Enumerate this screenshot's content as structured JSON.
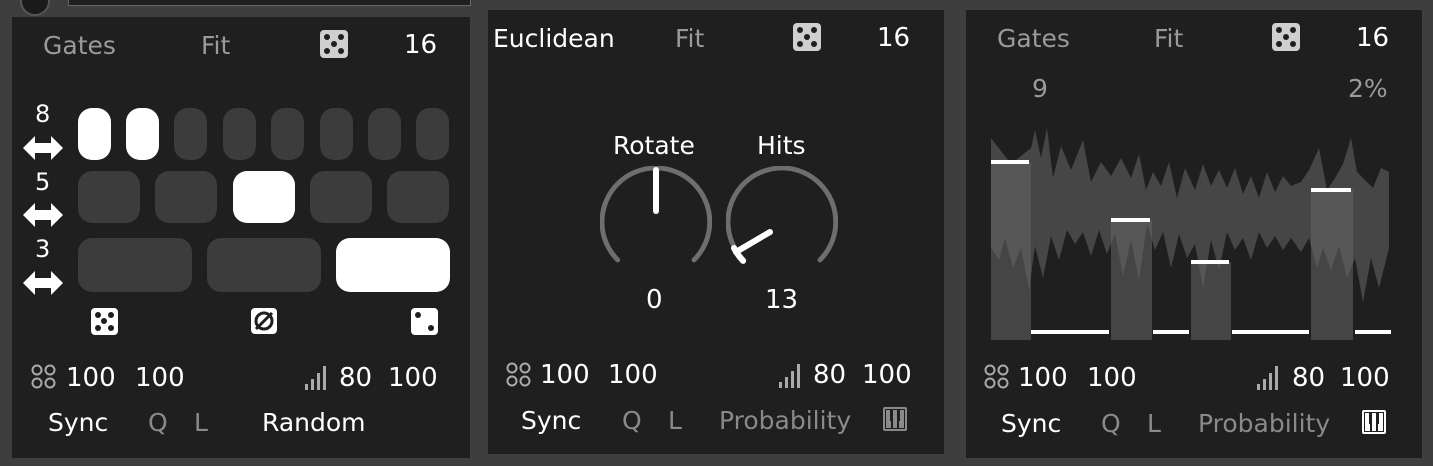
{
  "panel1": {
    "mode": "Gates",
    "fit": "Fit",
    "steps": "16",
    "row_counts": [
      "8",
      "5",
      "3"
    ],
    "velocity": "100",
    "gate_length": "100",
    "probability": "80",
    "level": "100",
    "sync": "Sync",
    "q": "Q",
    "l": "L",
    "source": "Random"
  },
  "panel2": {
    "mode": "Euclidean",
    "fit": "Fit",
    "steps": "16",
    "rotate_label": "Rotate",
    "rotate_value": "0",
    "hits_label": "Hits",
    "hits_value": "13",
    "velocity": "100",
    "gate_length": "100",
    "probability": "80",
    "level": "100",
    "sync": "Sync",
    "q": "Q",
    "l": "L",
    "source": "Probability"
  },
  "panel3": {
    "mode": "Gates",
    "fit": "Fit",
    "steps": "16",
    "left_value": "9",
    "right_value": "2%",
    "velocity": "100",
    "gate_length": "100",
    "probability": "80",
    "level": "100",
    "sync": "Sync",
    "q": "Q",
    "l": "L",
    "source": "Probability"
  },
  "colors": {
    "panel_bg": "#1f1f1f",
    "page_bg": "#3e3e3e",
    "active": "#ffffff",
    "inactive": "#3c3c3c",
    "muted_text": "#9a9a9a"
  }
}
